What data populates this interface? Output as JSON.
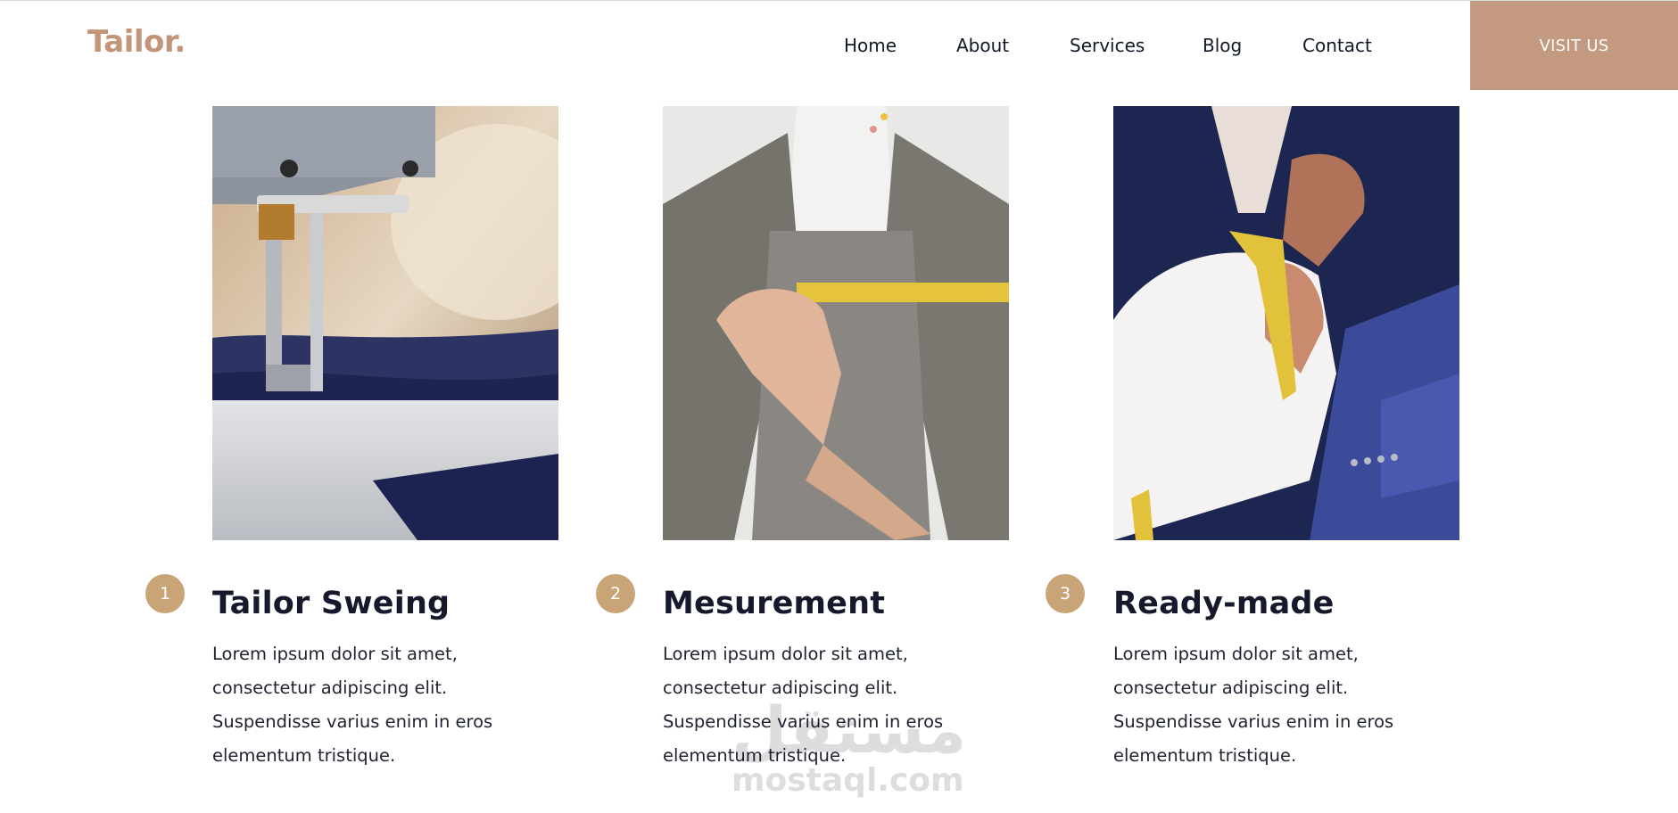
{
  "brand": {
    "logo": "Tailor."
  },
  "nav": {
    "items": [
      {
        "label": "Home"
      },
      {
        "label": "About"
      },
      {
        "label": "Services"
      },
      {
        "label": "Blog"
      },
      {
        "label": "Contact"
      }
    ],
    "cta": "VISIT US"
  },
  "services": [
    {
      "number": "1",
      "title": "Tailor Sweing",
      "text": "Lorem ipsum dolor sit amet, consectetur adipiscing elit. Suspendisse varius enim in eros elementum tristique."
    },
    {
      "number": "2",
      "title": "Mesurement",
      "text": "Lorem ipsum dolor sit amet, consectetur adipiscing elit. Suspendisse varius enim in eros elementum tristique."
    },
    {
      "number": "3",
      "title": "Ready-made",
      "text": "Lorem ipsum dolor sit amet, consectetur adipiscing elit. Suspendisse varius enim in eros elementum tristique."
    }
  ],
  "watermark": {
    "arabic": "مستقل",
    "latin": "mostaql.com"
  },
  "colors": {
    "accent": "#c39a7f",
    "logo": "#c29478",
    "badge": "#c8a476",
    "heading": "#16192c"
  }
}
